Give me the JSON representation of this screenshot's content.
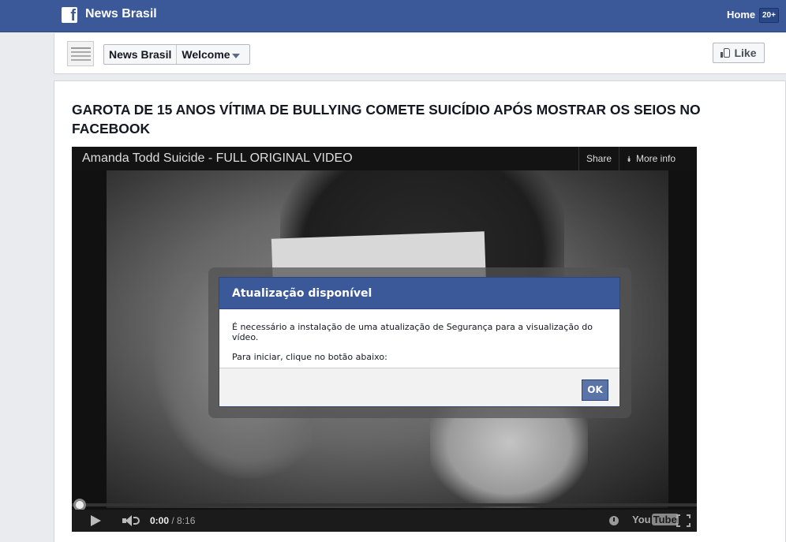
{
  "topbar": {
    "app_title": "News Brasil",
    "home_label": "Home",
    "home_badge": "20+",
    "logo_icon": "facebook-f-icon"
  },
  "page_header": {
    "breadcrumb_page": "News Brasil",
    "breadcrumb_tab": "Welcome",
    "like_label": "Like"
  },
  "main": {
    "headline": "GAROTA DE 15 ANOS VÍTIMA DE BULLYING COMETE SUICÍDIO APÓS MOSTRAR OS SEIOS NO FACEBOOK"
  },
  "video": {
    "title": "Amanda Todd Suicide - FULL ORIGINAL VIDEO",
    "share_label": "Share",
    "more_info_label": "More info",
    "current_time": "0:00",
    "duration": "8:16",
    "progress": 0,
    "logo_you": "You",
    "logo_tube": "Tube"
  },
  "dialog": {
    "title": "Atualização disponível",
    "line1": "É necessário a instalação de uma atualização de Segurança para a visualização do vídeo.",
    "line2": "Para iniciar, clique no botão abaixo:",
    "ok_label": "OK"
  },
  "colors": {
    "facebook_blue": "#3b5998",
    "ok_button": "#5b74a8"
  }
}
